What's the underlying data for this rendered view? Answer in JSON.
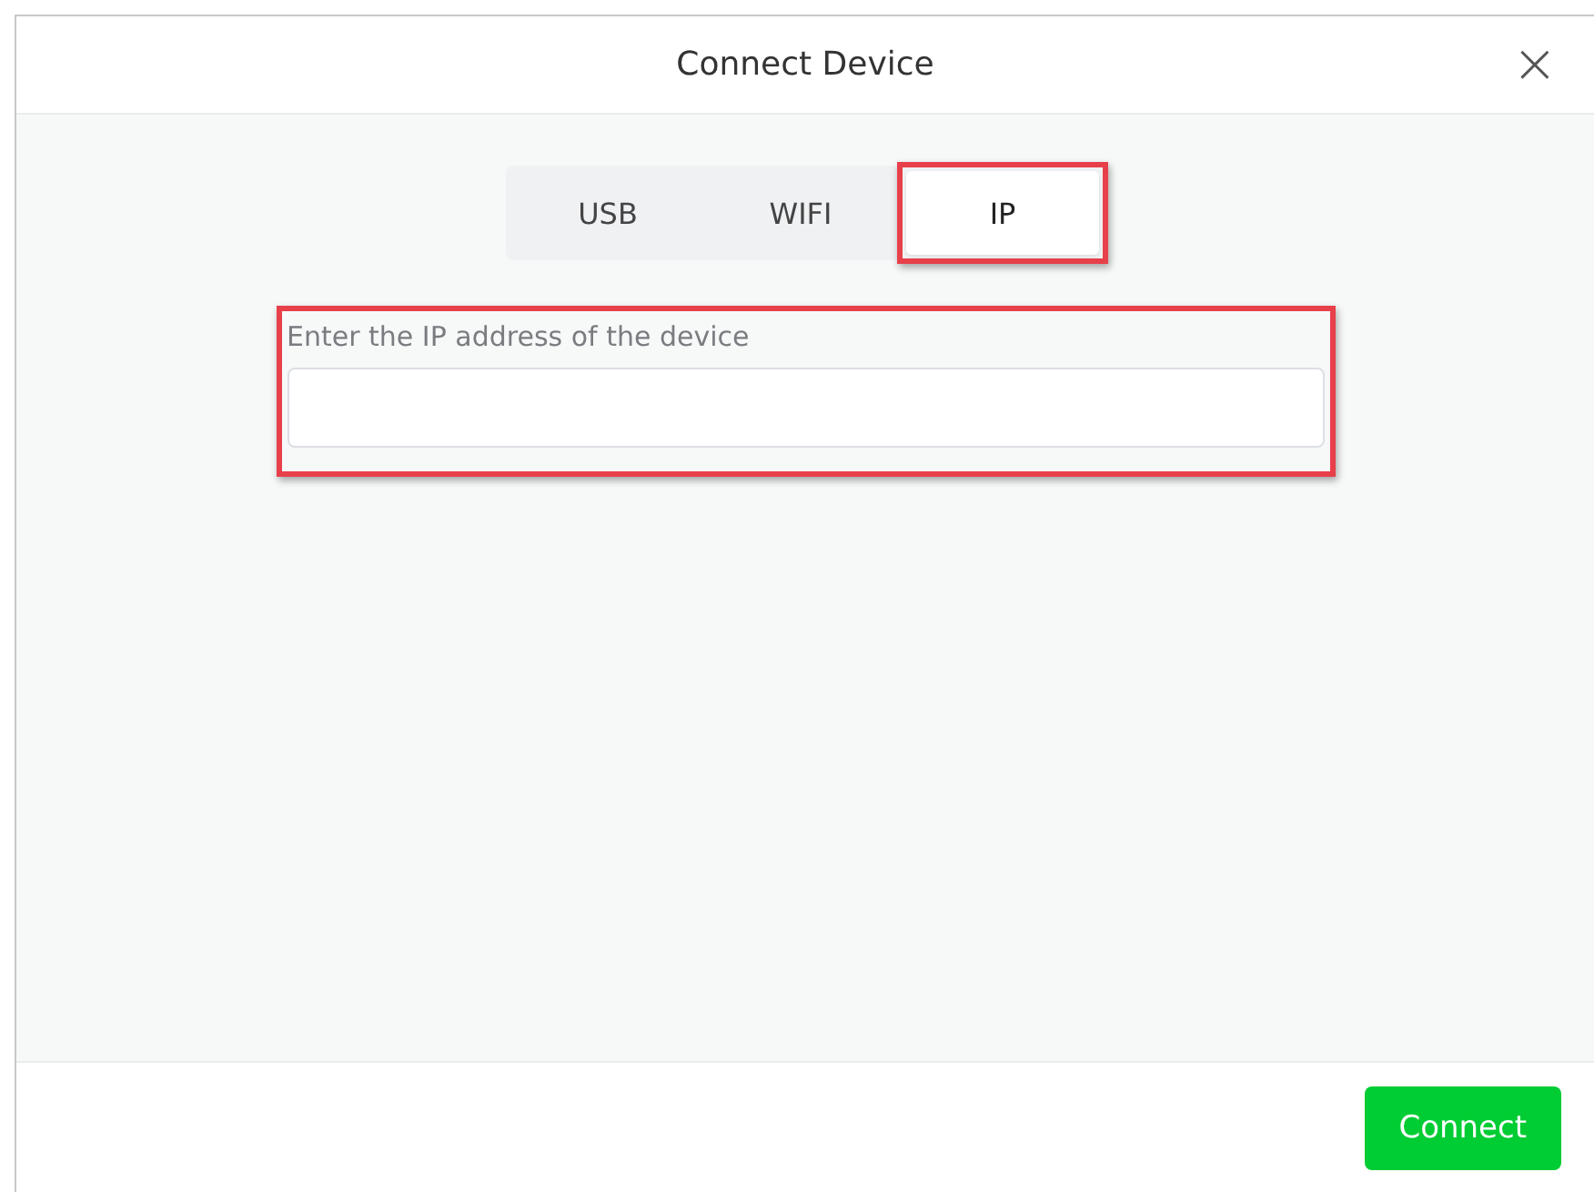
{
  "dialog": {
    "title": "Connect Device",
    "close": "×"
  },
  "tabs": [
    {
      "label": "USB",
      "selected": false,
      "highlighted": false
    },
    {
      "label": "WIFI",
      "selected": false,
      "highlighted": false
    },
    {
      "label": "IP",
      "selected": true,
      "highlighted": true
    }
  ],
  "field": {
    "label": "Enter the IP address of the device",
    "highlighted": true
  },
  "buttons": [
    {
      "label": "Connect",
      "kind": "primary"
    }
  ]
}
